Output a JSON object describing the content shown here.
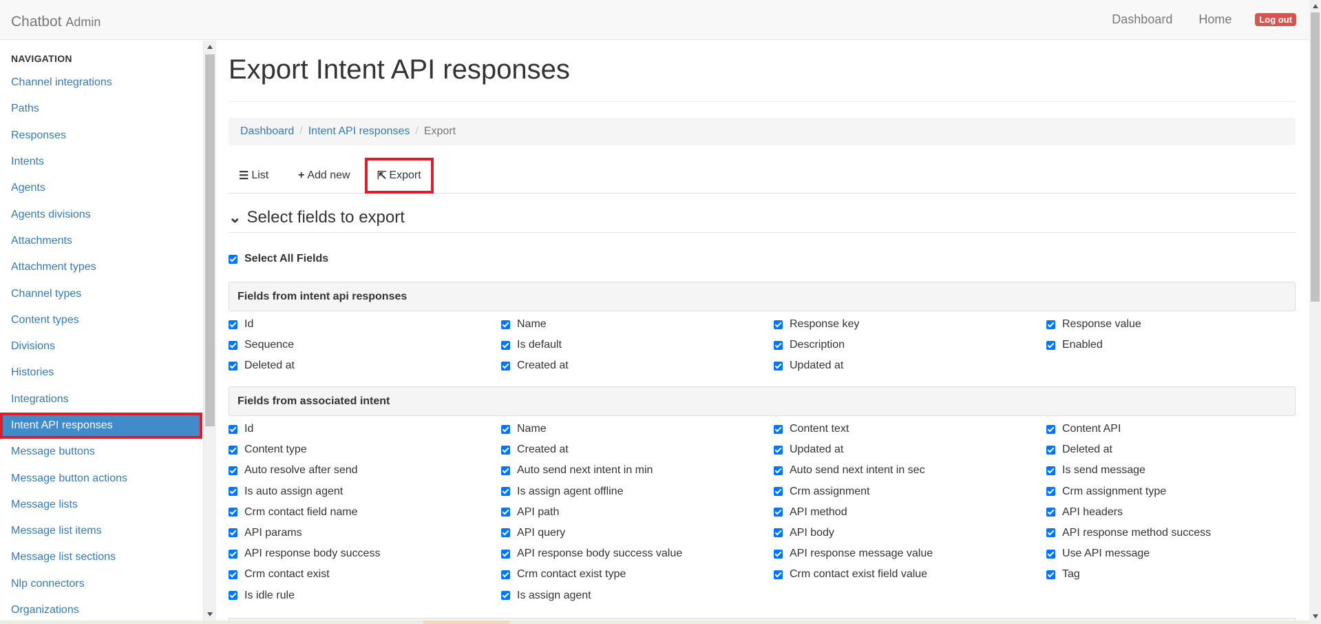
{
  "header": {
    "brand": "Chatbot",
    "brand_sub": "Admin",
    "nav": [
      "Dashboard",
      "Home"
    ],
    "logout": "Log out"
  },
  "sidebar": {
    "heading": "NAVIGATION",
    "items": [
      "Channel integrations",
      "Paths",
      "Responses",
      "Intents",
      "Agents",
      "Agents divisions",
      "Attachments",
      "Attachment types",
      "Channel types",
      "Content types",
      "Divisions",
      "Histories",
      "Integrations",
      "Intent API responses",
      "Message buttons",
      "Message button actions",
      "Message lists",
      "Message list items",
      "Message list sections",
      "Nlp connectors",
      "Organizations"
    ],
    "active": "Intent API responses"
  },
  "main": {
    "title": "Export Intent API responses",
    "breadcrumb": {
      "items": [
        "Dashboard",
        "Intent API responses"
      ],
      "current": "Export"
    },
    "tabs": {
      "list": "List",
      "add_new": "Add new",
      "export": "Export"
    },
    "section_title": "Select fields to export",
    "select_all": "Select All Fields",
    "groups": [
      {
        "title": "Fields from intent api responses",
        "fields": [
          "Id",
          "Name",
          "Response key",
          "Response value",
          "Sequence",
          "Is default",
          "Description",
          "Enabled",
          "Deleted at",
          "Created at",
          "Updated at"
        ]
      },
      {
        "title": "Fields from associated intent",
        "fields": [
          "Id",
          "Name",
          "Content text",
          "Content API",
          "Content type",
          "Created at",
          "Updated at",
          "Deleted at",
          "Auto resolve after send",
          "Auto send next intent in min",
          "Auto send next intent in sec",
          "Is send message",
          "Is auto assign agent",
          "Is assign agent offline",
          "Crm assignment",
          "Crm assignment type",
          "Crm contact field name",
          "API path",
          "API method",
          "API headers",
          "API params",
          "API query",
          "API body",
          "API response method success",
          "API response body success",
          "API response body success value",
          "API response message value",
          "Use API message",
          "Crm contact exist",
          "Crm contact exist type",
          "Crm contact exist field value",
          "Tag",
          "Is idle rule",
          "Is assign agent"
        ]
      }
    ]
  },
  "colors": {
    "link": "#337ab7",
    "active_bg": "#428bca",
    "highlight": "#dd1e2a",
    "logout": "#d9534f",
    "checkbox": "#0075ff"
  }
}
